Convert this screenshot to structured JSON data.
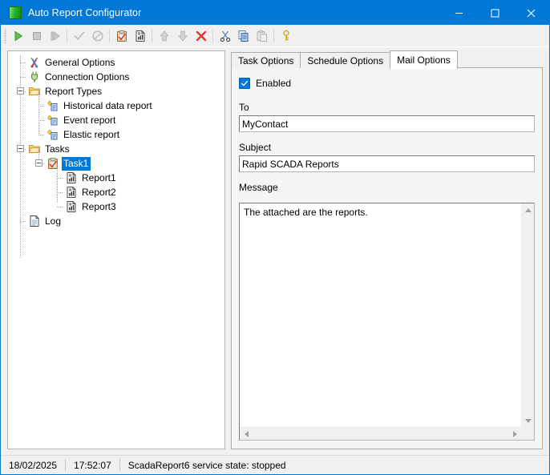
{
  "window": {
    "title": "Auto Report Configurator",
    "icon": "green-report-icon",
    "minimize_label": "Minimize",
    "maximize_label": "Maximize",
    "close_label": "Close"
  },
  "toolbar": {
    "buttons": [
      {
        "name": "start-button",
        "icon": "play-icon",
        "enabled": true
      },
      {
        "name": "stop-button",
        "icon": "stop-icon",
        "enabled": false
      },
      {
        "name": "step-button",
        "icon": "step-icon",
        "enabled": false
      },
      {
        "name": "separator-1",
        "icon": "separator",
        "enabled": false
      },
      {
        "name": "apply-button",
        "icon": "check-icon",
        "enabled": false
      },
      {
        "name": "cancel-button",
        "icon": "prohibited-icon",
        "enabled": false
      },
      {
        "name": "separator-2",
        "icon": "separator",
        "enabled": false
      },
      {
        "name": "add-task-button",
        "icon": "clipboard-check-icon",
        "enabled": true
      },
      {
        "name": "add-report-button",
        "icon": "report-document-icon",
        "enabled": true
      },
      {
        "name": "separator-3",
        "icon": "separator",
        "enabled": false
      },
      {
        "name": "move-up-button",
        "icon": "arrow-up-icon",
        "enabled": false
      },
      {
        "name": "move-down-button",
        "icon": "arrow-down-icon",
        "enabled": false
      },
      {
        "name": "delete-button",
        "icon": "red-x-icon",
        "enabled": true
      },
      {
        "name": "separator-4",
        "icon": "separator",
        "enabled": false
      },
      {
        "name": "cut-button",
        "icon": "scissors-icon",
        "enabled": true
      },
      {
        "name": "copy-button",
        "icon": "copy-icon",
        "enabled": true
      },
      {
        "name": "paste-button",
        "icon": "paste-icon",
        "enabled": false
      },
      {
        "name": "separator-5",
        "icon": "separator",
        "enabled": false
      },
      {
        "name": "register-button",
        "icon": "key-icon",
        "enabled": true
      }
    ]
  },
  "tree": {
    "nodes": [
      {
        "label": "General Options",
        "icon": "tools-icon",
        "level": 0,
        "selected": false
      },
      {
        "label": "Connection Options",
        "icon": "plug-icon",
        "level": 0,
        "selected": false
      },
      {
        "label": "Report Types",
        "icon": "folder-icon",
        "level": 0,
        "selected": false,
        "expander": "minus"
      },
      {
        "label": "Historical data report",
        "icon": "report-type-icon",
        "level": 1,
        "selected": false
      },
      {
        "label": "Event report",
        "icon": "report-type-icon",
        "level": 1,
        "selected": false
      },
      {
        "label": "Elastic report",
        "icon": "report-type-icon",
        "level": 1,
        "selected": false
      },
      {
        "label": "Tasks",
        "icon": "folder-icon",
        "level": 0,
        "selected": false,
        "expander": "minus"
      },
      {
        "label": "Task1",
        "icon": "clipboard-check-icon",
        "level": 1,
        "selected": true,
        "expander": "minus"
      },
      {
        "label": "Report1",
        "icon": "report-document-icon",
        "level": 2,
        "selected": false
      },
      {
        "label": "Report2",
        "icon": "report-document-icon",
        "level": 2,
        "selected": false
      },
      {
        "label": "Report3",
        "icon": "report-document-icon",
        "level": 2,
        "selected": false
      },
      {
        "label": "Log",
        "icon": "log-document-icon",
        "level": 0,
        "selected": false
      }
    ]
  },
  "tabs": [
    {
      "label": "Task Options",
      "active": false
    },
    {
      "label": "Schedule Options",
      "active": false
    },
    {
      "label": "Mail Options",
      "active": true
    }
  ],
  "mail_options": {
    "enabled_label": "Enabled",
    "enabled_checked": true,
    "to_label": "To",
    "to_value": "MyContact",
    "subject_label": "Subject",
    "subject_value": "Rapid SCADA Reports",
    "message_label": "Message",
    "message_value": "The attached are the reports."
  },
  "statusbar": {
    "date": "18/02/2025",
    "time": "17:52:07",
    "message": "ScadaReport6 service state: stopped"
  },
  "colors": {
    "accent": "#0078d7",
    "selection": "#0078d7",
    "window_bg": "#f0f0f0",
    "field_bg": "#ffffff",
    "delete_red": "#e03b30",
    "play_green": "#3faf3f"
  }
}
